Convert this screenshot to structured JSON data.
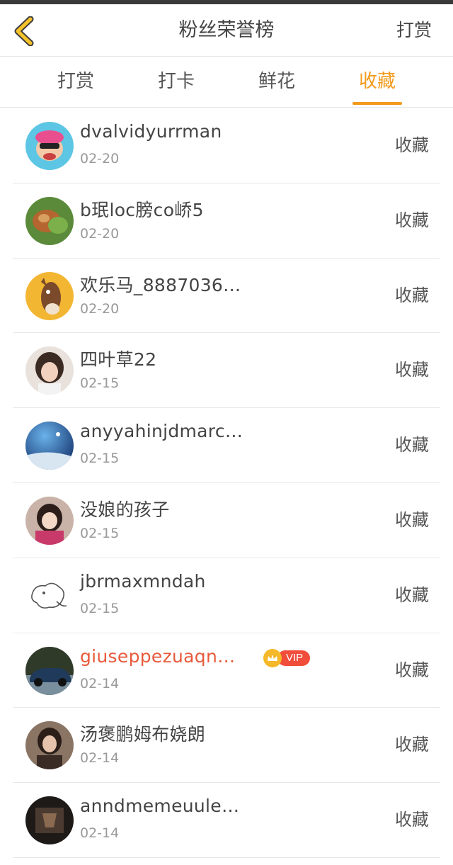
{
  "header": {
    "title": "粉丝荣誉榜",
    "right_action": "打赏",
    "accent": "#f39a1b"
  },
  "tabs": [
    {
      "label": "打赏",
      "active": false
    },
    {
      "label": "打卡",
      "active": false
    },
    {
      "label": "鲜花",
      "active": false
    },
    {
      "label": "收藏",
      "active": true
    }
  ],
  "list": [
    {
      "name": "dvalvidyurrman",
      "date": "02-20",
      "action": "收藏",
      "avatar": "cartoon-monkey",
      "vip": false
    },
    {
      "name": "b珉loc膀co峤5",
      "date": "02-20",
      "action": "收藏",
      "avatar": "flower-bud",
      "vip": false
    },
    {
      "name": "欢乐马_8887036…",
      "date": "02-20",
      "action": "收藏",
      "avatar": "cartoon-horse",
      "vip": false
    },
    {
      "name": "四叶草22",
      "date": "02-15",
      "action": "收藏",
      "avatar": "girl-photo",
      "vip": false
    },
    {
      "name": "anyyahinjdmarc…",
      "date": "02-15",
      "action": "收藏",
      "avatar": "night-sky",
      "vip": false
    },
    {
      "name": "没娘的孩子",
      "date": "02-15",
      "action": "收藏",
      "avatar": "child-photo",
      "vip": false
    },
    {
      "name": "jbrmaxmndah",
      "date": "02-15",
      "action": "收藏",
      "avatar": "doodle-dog",
      "vip": false
    },
    {
      "name": "giuseppezuaqn…",
      "date": "02-14",
      "action": "收藏",
      "avatar": "vintage-car",
      "vip": true,
      "vip_label": "VIP"
    },
    {
      "name": "汤褒鹏姆布娆朗",
      "date": "02-14",
      "action": "收藏",
      "avatar": "woman-photo",
      "vip": false
    },
    {
      "name": "anndmemeuule…",
      "date": "02-14",
      "action": "收藏",
      "avatar": "dark-photo",
      "vip": false
    }
  ]
}
